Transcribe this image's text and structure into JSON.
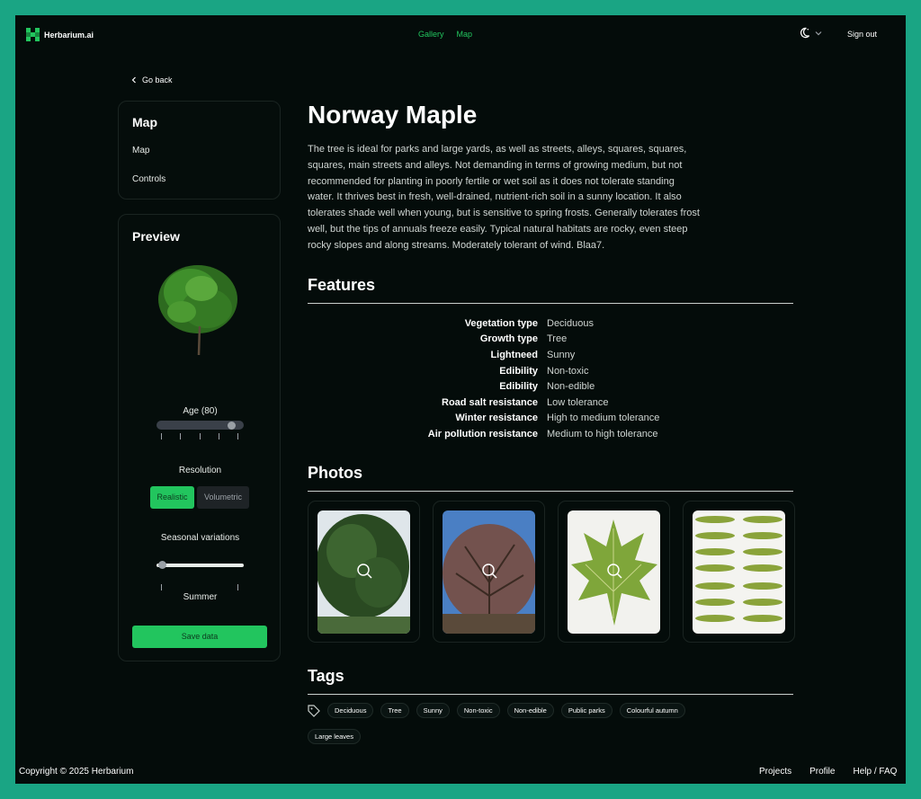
{
  "header": {
    "logo_text": "Herbarium.ai",
    "nav": [
      "Gallery",
      "Map"
    ],
    "theme_icon": "moon-icon",
    "sign_out": "Sign out"
  },
  "sidebar": {
    "go_back": "Go back",
    "map_card": {
      "title": "Map",
      "items": [
        "Map",
        "Controls"
      ]
    },
    "preview": {
      "title": "Preview",
      "age_label": "Age (80)",
      "age_value_fraction": 0.85,
      "resolution_label": "Resolution",
      "resolution_options": [
        "Realistic",
        "Volumetric"
      ],
      "resolution_selected": "Realistic",
      "seasonal_label": "Seasonal variations",
      "seasonal_value": "Summer",
      "seasonal_value_fraction": 0.05,
      "save_label": "Save data"
    }
  },
  "main": {
    "title": "Norway Maple",
    "description": "The tree is ideal for parks and large yards, as well as streets, alleys, squares, squares, squares, main streets and alleys. Not demanding in terms of growing medium, but not recommended for planting in poorly fertile or wet soil as it does not tolerate standing water. It thrives best in fresh, well-drained, nutrient-rich soil in a sunny location. It also tolerates shade well when young, but is sensitive to spring frosts. Generally tolerates frost well, but the tips of annuals freeze easily. Typical natural habitats are rocky, even steep rocky slopes and along streams. Moderately tolerant of wind. Blaa7.",
    "features_heading": "Features",
    "features": [
      {
        "k": "Vegetation type",
        "v": "Deciduous"
      },
      {
        "k": "Growth type",
        "v": "Tree"
      },
      {
        "k": "Lightneed",
        "v": "Sunny"
      },
      {
        "k": "Edibility",
        "v": "Non-toxic"
      },
      {
        "k": "Edibility",
        "v": "Non-edible"
      },
      {
        "k": "Road salt resistance",
        "v": "Low tolerance"
      },
      {
        "k": "Winter resistance",
        "v": "High to medium tolerance"
      },
      {
        "k": "Air pollution resistance",
        "v": "Medium to high tolerance"
      }
    ],
    "photos_heading": "Photos",
    "photos": [
      "summer-tree-photo",
      "winter-tree-photo",
      "leaf-photo",
      "seeds-photo"
    ],
    "tags_heading": "Tags",
    "tags": [
      "Deciduous",
      "Tree",
      "Sunny",
      "Non-toxic",
      "Non-edible",
      "Public parks",
      "Colourful autumn",
      "Large leaves"
    ]
  },
  "footer": {
    "copyright": "Copyright © 2025 Herbarium",
    "links": [
      "Projects",
      "Profile",
      "Help / FAQ"
    ]
  },
  "colors": {
    "accent": "#22c55e",
    "frame": "#1aa584",
    "background": "#040c0a"
  }
}
